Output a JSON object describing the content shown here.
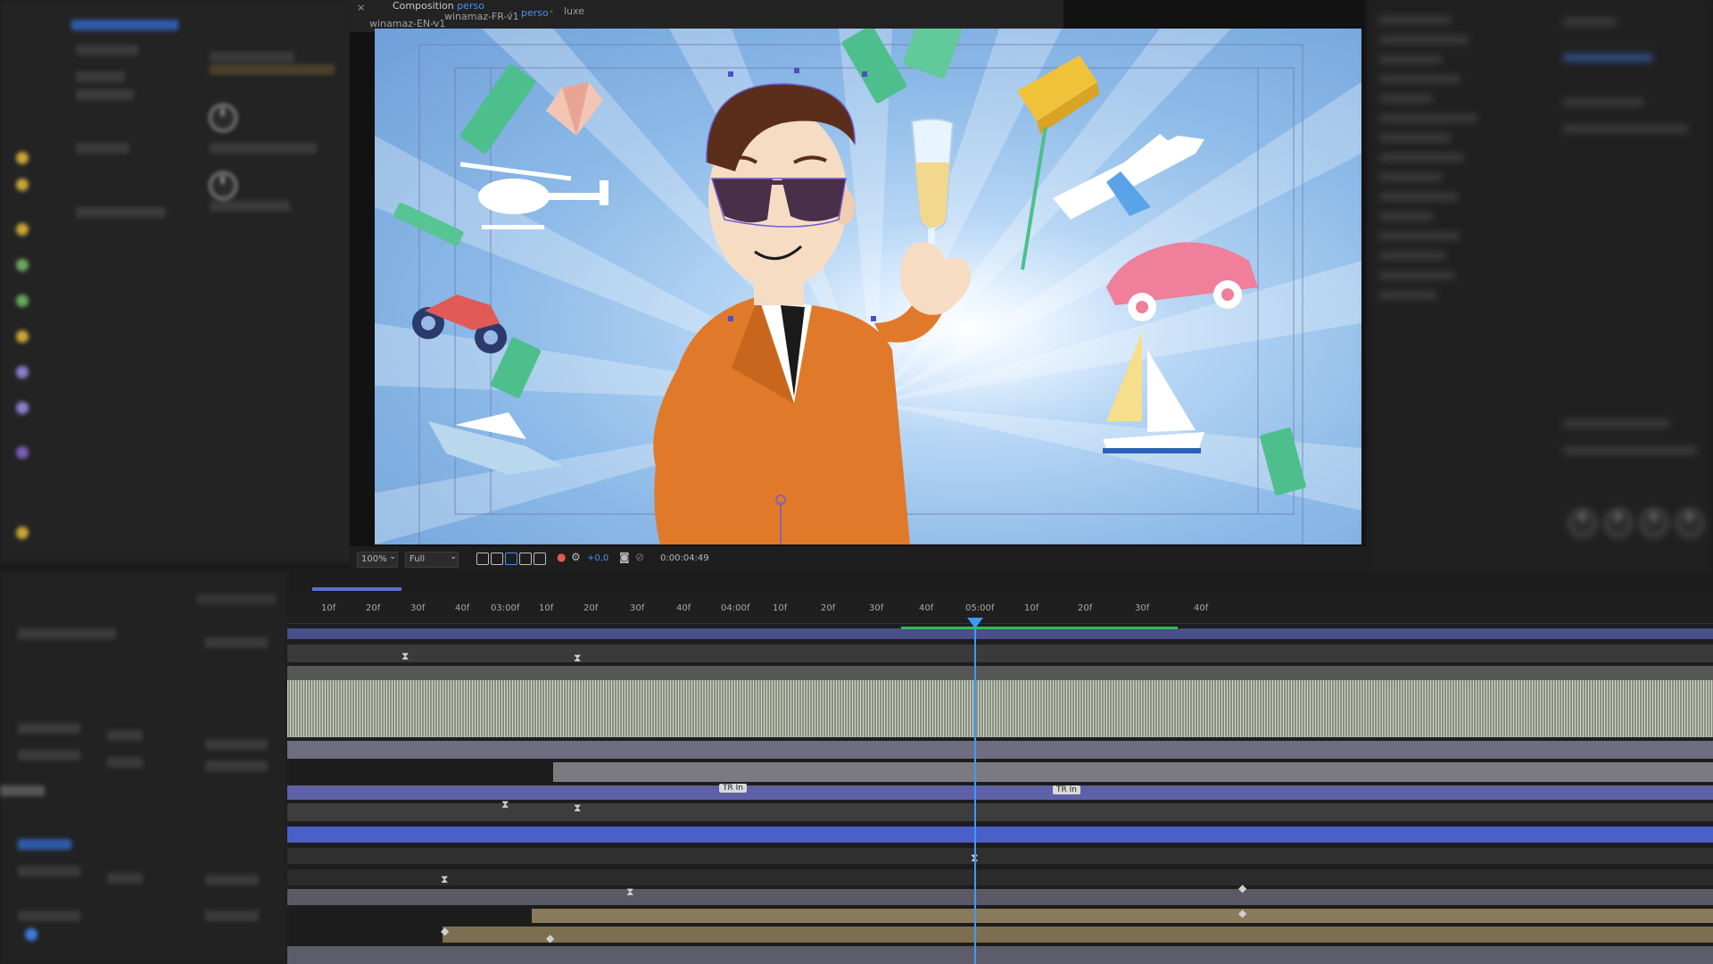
{
  "viewer": {
    "tabs": [
      {
        "label": "winamaz-EN-v1"
      },
      {
        "label": "winamaz-FR-v1"
      },
      {
        "label": "perso"
      },
      {
        "label": "luxe"
      }
    ],
    "panel_title": "Composition",
    "panel_title_suffix": "perso",
    "zoom": "100%",
    "resolution": "Full",
    "exposure": "+0,0",
    "timecode": "0:00:04:49"
  },
  "timeline": {
    "ruler_ticks": [
      "10f",
      "20f",
      "30f",
      "40f",
      "03:00f",
      "10f",
      "20f",
      "30f",
      "40f",
      "04:00f",
      "10f",
      "20f",
      "30f",
      "40f",
      "05:00f",
      "10f",
      "20f",
      "30f",
      "40f"
    ],
    "markers": [
      {
        "label": "TR In"
      },
      {
        "label": "TR In"
      }
    ]
  },
  "colors": {
    "accent": "#3a9bff",
    "tab_active": "#4a8ff0",
    "suit": "#e07a2a",
    "sky": "#8ebbe8"
  }
}
